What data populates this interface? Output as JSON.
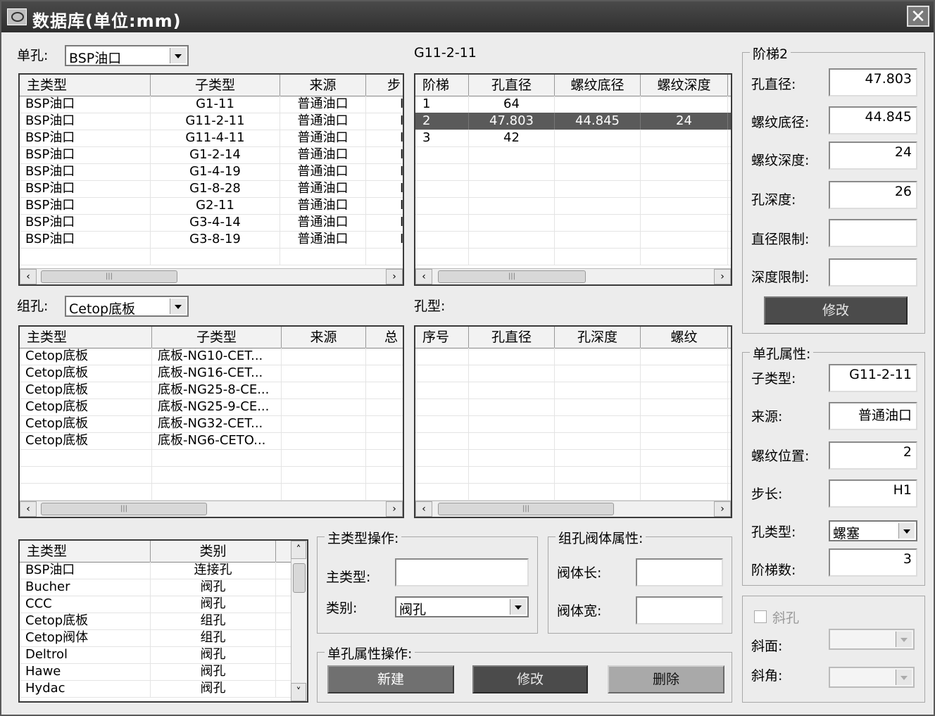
{
  "window": {
    "title": "数据库(单位:mm)",
    "close_glyph": "✕"
  },
  "single_hole": {
    "label": "单孔:",
    "combo_value": "BSP油口",
    "list": {
      "headers": [
        "主类型",
        "子类型",
        "来源",
        "步"
      ],
      "rows": [
        [
          "BSP油口",
          "G1-11",
          "普通油口",
          "I"
        ],
        [
          "BSP油口",
          "G11-2-11",
          "普通油口",
          "I"
        ],
        [
          "BSP油口",
          "G11-4-11",
          "普通油口",
          "I"
        ],
        [
          "BSP油口",
          "G1-2-14",
          "普通油口",
          "I"
        ],
        [
          "BSP油口",
          "G1-4-19",
          "普通油口",
          "I"
        ],
        [
          "BSP油口",
          "G1-8-28",
          "普通油口",
          "I"
        ],
        [
          "BSP油口",
          "G2-11",
          "普通油口",
          "I"
        ],
        [
          "BSP油口",
          "G3-4-14",
          "普通油口",
          "I"
        ],
        [
          "BSP油口",
          "G3-8-19",
          "普通油口",
          "I"
        ]
      ]
    }
  },
  "step_table": {
    "caption": "G11-2-11",
    "headers": [
      "阶梯",
      "孔直径",
      "螺纹底径",
      "螺纹深度"
    ],
    "rows": [
      [
        "1",
        "64",
        "",
        ""
      ],
      [
        "2",
        "47.803",
        "44.845",
        "24"
      ],
      [
        "3",
        "42",
        "",
        ""
      ]
    ]
  },
  "group_hole": {
    "label": "组孔:",
    "combo_value": "Cetop底板",
    "list": {
      "headers": [
        "主类型",
        "子类型",
        "来源",
        "总"
      ],
      "rows": [
        [
          "Cetop底板",
          "底板-NG10-CET..."
        ],
        [
          "Cetop底板",
          "底板-NG16-CET..."
        ],
        [
          "Cetop底板",
          "底板-NG25-8-CE..."
        ],
        [
          "Cetop底板",
          "底板-NG25-9-CE..."
        ],
        [
          "Cetop底板",
          "底板-NG32-CET..."
        ],
        [
          "Cetop底板",
          "底板-NG6-CETO..."
        ]
      ]
    }
  },
  "hole_type": {
    "caption": "孔型:",
    "headers": [
      "序号",
      "孔直径",
      "孔深度",
      "螺纹"
    ]
  },
  "main_types": {
    "headers": [
      "主类型",
      "类别"
    ],
    "rows": [
      [
        "BSP油口",
        "连接孔"
      ],
      [
        "Bucher",
        "阀孔"
      ],
      [
        "CCC",
        "阀孔"
      ],
      [
        "Cetop底板",
        "组孔"
      ],
      [
        "Cetop阀体",
        "组孔"
      ],
      [
        "Deltrol",
        "阀孔"
      ],
      [
        "Hawe",
        "阀孔"
      ],
      [
        "Hydac",
        "阀孔"
      ]
    ]
  },
  "main_type_ops": {
    "title": "主类型操作:",
    "main_type_label": "主类型:",
    "main_type_value": "",
    "category_label": "类别:",
    "category_value": "阀孔"
  },
  "valve_props": {
    "title": "组孔阀体属性:",
    "length_label": "阀体长:",
    "length_value": "",
    "width_label": "阀体宽:",
    "width_value": ""
  },
  "single_ops": {
    "title": "单孔属性操作:",
    "new_label": "新建",
    "modify_label": "修改",
    "delete_label": "删除"
  },
  "step2": {
    "title": "阶梯2",
    "diameter_label": "孔直径:",
    "diameter_value": "47.803",
    "thread_base_label": "螺纹底径:",
    "thread_base_value": "44.845",
    "thread_depth_label": "螺纹深度:",
    "thread_depth_value": "24",
    "hole_depth_label": "孔深度:",
    "hole_depth_value": "26",
    "dia_limit_label": "直径限制:",
    "dia_limit_value": "",
    "depth_limit_label": "深度限制:",
    "depth_limit_value": "",
    "modify_label": "修改"
  },
  "hole_props": {
    "title": "单孔属性:",
    "subtype_label": "子类型:",
    "subtype_value": "G11-2-11",
    "source_label": "来源:",
    "source_value": "普通油口",
    "thread_pos_label": "螺纹位置:",
    "thread_pos_value": "2",
    "step_label": "步长:",
    "step_value": "H1",
    "hole_kind_label": "孔类型:",
    "hole_kind_value": "螺塞",
    "step_count_label": "阶梯数:",
    "step_count_value": "3"
  },
  "incline": {
    "checkbox_label": "斜孔",
    "face_label": "斜面:",
    "face_value": "",
    "angle_label": "斜角:",
    "angle_value": ""
  },
  "icons": {
    "scroll_left": "‹",
    "scroll_right": "›",
    "scroll_up": "˄",
    "scroll_down": "˅",
    "grip": "|||"
  }
}
